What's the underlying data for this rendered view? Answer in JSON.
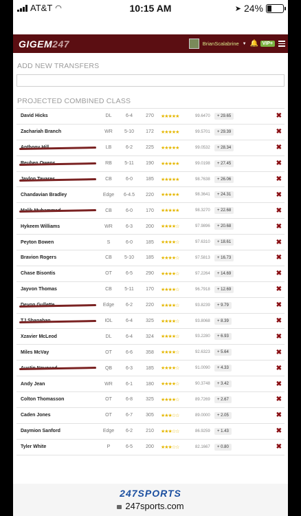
{
  "status_bar": {
    "carrier": "AT&T",
    "time": "10:15 AM",
    "battery": "24%",
    "battery_level": 0.24
  },
  "nav": {
    "logo_text": "GIGEM",
    "logo_num": "247",
    "username": "BrianScalabrine",
    "vip_label": "VIP+"
  },
  "add_transfers": {
    "title": "ADD NEW TRANSFERS",
    "placeholder": ""
  },
  "projected": {
    "title": "PROJECTED COMBINED CLASS",
    "remove_glyph": "✖",
    "players": [
      {
        "name": "David Hicks",
        "pos": "DL",
        "ht": "6-4",
        "wt": "270",
        "stars": "★★★★★",
        "rating": "99.6470",
        "bonus": "+ 29.65"
      },
      {
        "name": "Zachariah Branch",
        "pos": "WR",
        "ht": "5-10",
        "wt": "172",
        "stars": "★★★★★",
        "rating": "99.5701",
        "bonus": "+ 29.39"
      },
      {
        "name": "Anthony Hill",
        "pos": "LB",
        "ht": "6-2",
        "wt": "225",
        "stars": "★★★★★",
        "rating": "99.0532",
        "bonus": "+ 28.34",
        "redacted": true
      },
      {
        "name": "Reuben Owens",
        "pos": "RB",
        "ht": "5-11",
        "wt": "190",
        "stars": "★★★★★",
        "rating": "99.0198",
        "bonus": "+ 27.45",
        "redacted": true
      },
      {
        "name": "Jaylon Tavares",
        "pos": "CB",
        "ht": "6-0",
        "wt": "185",
        "stars": "★★★★★",
        "rating": "98.7638",
        "bonus": "+ 26.06",
        "redacted": true
      },
      {
        "name": "Chandavian Bradley",
        "pos": "Edge",
        "ht": "6-4.5",
        "wt": "220",
        "stars": "★★★★★",
        "rating": "98.3641",
        "bonus": "+ 24.31"
      },
      {
        "name": "Malik Muhammad",
        "pos": "CB",
        "ht": "6-0",
        "wt": "170",
        "stars": "★★★★★",
        "rating": "98.3270",
        "bonus": "+ 22.68",
        "redacted": true
      },
      {
        "name": "Hykeem Williams",
        "pos": "WR",
        "ht": "6-3",
        "wt": "200",
        "stars": "★★★★☆",
        "rating": "97.9896",
        "bonus": "+ 20.68"
      },
      {
        "name": "Peyton Bowen",
        "pos": "S",
        "ht": "6-0",
        "wt": "185",
        "stars": "★★★★☆",
        "rating": "97.6310",
        "bonus": "+ 18.61"
      },
      {
        "name": "Bravion Rogers",
        "pos": "CB",
        "ht": "5-10",
        "wt": "185",
        "stars": "★★★★☆",
        "rating": "97.5813",
        "bonus": "+ 16.73"
      },
      {
        "name": "Chase Bisontis",
        "pos": "OT",
        "ht": "6-5",
        "wt": "290",
        "stars": "★★★★☆",
        "rating": "97.2264",
        "bonus": "+ 14.69"
      },
      {
        "name": "Jayvon Thomas",
        "pos": "CB",
        "ht": "5-11",
        "wt": "170",
        "stars": "★★★★☆",
        "rating": "96.7918",
        "bonus": "+ 12.69"
      },
      {
        "name": "Devon Gullette",
        "pos": "Edge",
        "ht": "6-2",
        "wt": "220",
        "stars": "★★★★☆",
        "rating": "93.8239",
        "bonus": "+ 9.79",
        "redacted": true
      },
      {
        "name": "TJ Shanahan",
        "pos": "IOL",
        "ht": "6-4",
        "wt": "325",
        "stars": "★★★★☆",
        "rating": "93.8068",
        "bonus": "+ 8.39",
        "redacted": true
      },
      {
        "name": "Xzavier McLeod",
        "pos": "DL",
        "ht": "6-4",
        "wt": "324",
        "stars": "★★★★☆",
        "rating": "93.2280",
        "bonus": "+ 6.93"
      },
      {
        "name": "Miles McVay",
        "pos": "OT",
        "ht": "6-6",
        "wt": "358",
        "stars": "★★★★☆",
        "rating": "92.6323",
        "bonus": "+ 5.64"
      },
      {
        "name": "Austin Novosad",
        "pos": "QB",
        "ht": "6-3",
        "wt": "185",
        "stars": "★★★★☆",
        "rating": "91.0090",
        "bonus": "+ 4.33",
        "redacted": true
      },
      {
        "name": "Andy Jean",
        "pos": "WR",
        "ht": "6-1",
        "wt": "180",
        "stars": "★★★★☆",
        "rating": "90.3748",
        "bonus": "+ 3.42"
      },
      {
        "name": "Colton Thomasson",
        "pos": "OT",
        "ht": "6-8",
        "wt": "325",
        "stars": "★★★★☆",
        "rating": "89.7269",
        "bonus": "+ 2.67"
      },
      {
        "name": "Caden Jones",
        "pos": "OT",
        "ht": "6-7",
        "wt": "305",
        "stars": "★★★☆☆",
        "rating": "89.0000",
        "bonus": "+ 2.05"
      },
      {
        "name": "Daymion Sanford",
        "pos": "Edge",
        "ht": "6-2",
        "wt": "210",
        "stars": "★★★☆☆",
        "rating": "86.9259",
        "bonus": "+ 1.43"
      },
      {
        "name": "Tyler White",
        "pos": "P",
        "ht": "6-5",
        "wt": "200",
        "stars": "★★★☆☆",
        "rating": "82.1667",
        "bonus": "+ 0.80"
      }
    ]
  },
  "footer": {
    "brand": "247SPORTS",
    "url": "247sports.com"
  },
  "colors": {
    "nav_bg": "#5b0e12",
    "remove": "#8b1015",
    "stars": "#e5b700",
    "vip": "#7cb342"
  }
}
